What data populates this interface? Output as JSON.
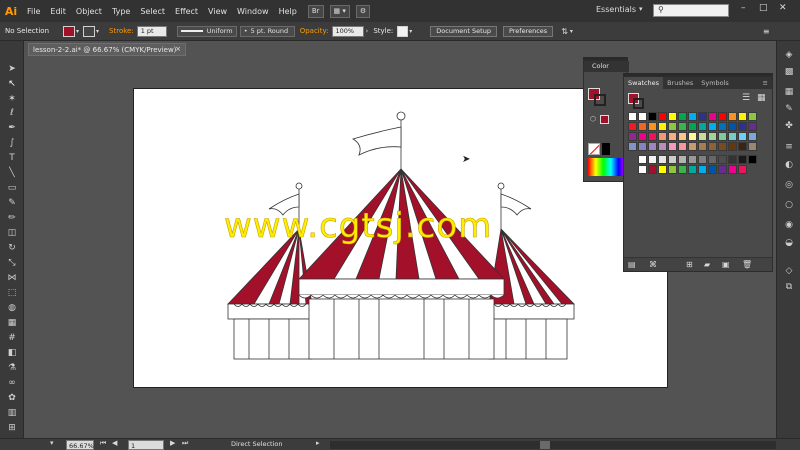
{
  "app": {
    "logo": "Ai"
  },
  "menu": [
    "File",
    "Edit",
    "Object",
    "Type",
    "Select",
    "Effect",
    "View",
    "Window",
    "Help"
  ],
  "menubar": {
    "bridge_label": "Br",
    "workspace": "Essentials"
  },
  "controlbar": {
    "selection": "No Selection",
    "stroke_label": "Stroke:",
    "stroke_weight": "1 pt",
    "stroke_profile": "Uniform",
    "brush": "5 pt. Round",
    "opacity_label": "Opacity:",
    "opacity_value": "100%",
    "style_label": "Style:",
    "document_setup": "Document Setup",
    "preferences": "Preferences"
  },
  "document": {
    "tab_title": "lesson-2-2.ai* @ 66.67% (CMYK/Preview)",
    "close": "×"
  },
  "color_panel": {
    "title": "Color",
    "fill_color": "#a3102a"
  },
  "swatches_panel": {
    "tabs": [
      "Swatches",
      "Brushes",
      "Symbols"
    ],
    "active_tab": "Swatches",
    "fill_color": "#a3102a",
    "rows": [
      [
        "#ffffff",
        "#ffffff",
        "#000000",
        "#ff0000",
        "#ffff00",
        "#00a650",
        "#00aeef",
        "#2e3192",
        "#ec008c",
        "#ff0000",
        "#f7941d",
        "#fff200",
        "#8dc63f"
      ],
      [
        "#ed1c24",
        "#f26522",
        "#f7941d",
        "#fff200",
        "#8dc63f",
        "#39b54a",
        "#00a651",
        "#00a99d",
        "#00aeef",
        "#0072bc",
        "#0054a6",
        "#2e3192",
        "#662d91"
      ],
      [
        "#92278f",
        "#ec008c",
        "#ed145b",
        "#f69679",
        "#f9ad81",
        "#fdc689",
        "#fff799",
        "#c4df9b",
        "#a3d39c",
        "#82ca9c",
        "#7accc8",
        "#6dcff6",
        "#7da7d9"
      ],
      [
        "#8393ca",
        "#8882be",
        "#a186be",
        "#bd8cbf",
        "#f49ac1",
        "#f5989d",
        "#c69c6d",
        "#a67c52",
        "#8c6239",
        "#754c24",
        "#603913",
        "#3c2415",
        "#998675"
      ]
    ],
    "gray_row": [
      "#ffffff",
      "#f2f2f2",
      "#e6e6e6",
      "#cccccc",
      "#b3b3b3",
      "#999999",
      "#808080",
      "#666666",
      "#4d4d4d",
      "#333333",
      "#1a1a1a",
      "#000000"
    ],
    "last_row": [
      "#ffffff",
      "#a3102a",
      "#ffff00",
      "#8dc63f",
      "#39b54a",
      "#00a99d",
      "#00aeef",
      "#0054a6",
      "#662d91",
      "#ec008c",
      "#ed145b"
    ]
  },
  "statusbar": {
    "zoom": "66.67%",
    "artboard": "1",
    "tool": "Direct Selection"
  },
  "watermark": "www.cgtsj.com",
  "colors": {
    "accent": "#ff9a00",
    "tent_red": "#a3102a"
  }
}
